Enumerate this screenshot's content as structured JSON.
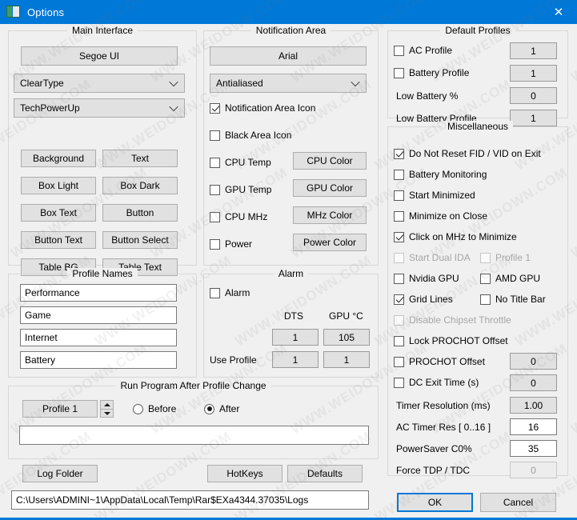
{
  "window": {
    "title": "Options",
    "icon": "app-icon",
    "close_label": "✕",
    "accent_color": "#0078d7"
  },
  "watermark": {
    "text": "WWW.WEIDOWN.COM"
  },
  "main_interface": {
    "legend": "Main Interface",
    "font_button": "Segoe UI",
    "rendering_combo": "ClearType",
    "theme_combo": "TechPowerUp",
    "color_buttons": [
      "Background",
      "Text",
      "Box Light",
      "Box Dark",
      "Box Text",
      "Button",
      "Button Text",
      "Button Select",
      "Table BG",
      "Table Text"
    ]
  },
  "notification_area": {
    "legend": "Notification Area",
    "font_button": "Arial",
    "rendering_combo": "Antialiased",
    "checks": [
      {
        "label": "Notification Area Icon",
        "checked": true
      },
      {
        "label": "Black Area Icon",
        "checked": false
      },
      {
        "label": "CPU Temp",
        "checked": false
      },
      {
        "label": "GPU Temp",
        "checked": false
      },
      {
        "label": "CPU MHz",
        "checked": false
      },
      {
        "label": "Power",
        "checked": false
      }
    ],
    "color_buttons": [
      "CPU Color",
      "GPU Color",
      "MHz Color",
      "Power Color"
    ]
  },
  "profile_names": {
    "legend": "Profile Names",
    "values": [
      "Performance",
      "Game",
      "Internet",
      "Battery"
    ]
  },
  "alarm": {
    "legend": "Alarm",
    "enable_label": "Alarm",
    "enable_checked": false,
    "col_dts": "DTS",
    "col_gpu": "GPU °C",
    "temp_dts": "1",
    "temp_gpu": "105",
    "use_profile_label": "Use Profile",
    "profile_dts": "1",
    "profile_gpu": "1"
  },
  "run_program": {
    "legend": "Run Program After Profile Change",
    "profile_button": "Profile 1",
    "radio_before": "Before",
    "radio_after": "After",
    "selected_radio": "After",
    "command_value": "",
    "command_placeholder": ""
  },
  "footer": {
    "log_folder_button": "Log Folder",
    "hotkeys_button": "HotKeys",
    "defaults_button": "Defaults",
    "log_path": "C:\\Users\\ADMINI~1\\AppData\\Local\\Temp\\Rar$EXa4344.37035\\Logs"
  },
  "default_profiles": {
    "legend": "Default Profiles",
    "rows": [
      {
        "label": "AC Profile",
        "type": "check",
        "checked": false,
        "value": "1",
        "field": "grey"
      },
      {
        "label": "Battery Profile",
        "type": "check",
        "checked": false,
        "value": "1",
        "field": "grey"
      },
      {
        "label": "Low Battery %",
        "type": "label",
        "checked": false,
        "value": "0",
        "field": "grey"
      },
      {
        "label": "Low Battery Profile",
        "type": "label",
        "checked": false,
        "value": "1",
        "field": "grey"
      }
    ]
  },
  "miscellaneous": {
    "legend": "Miscellaneous",
    "checks": [
      {
        "label": "Do Not Reset FID / VID on Exit",
        "checked": true,
        "disabled": false
      },
      {
        "label": "Battery Monitoring",
        "checked": false,
        "disabled": false
      },
      {
        "label": "Start Minimized",
        "checked": false,
        "disabled": false
      },
      {
        "label": "Minimize on Close",
        "checked": false,
        "disabled": false
      },
      {
        "label": "Click on MHz to Minimize",
        "checked": true,
        "disabled": false
      }
    ],
    "pairs": [
      {
        "left": {
          "label": "Start Dual IDA",
          "checked": false,
          "disabled": true
        },
        "right": {
          "label": "Profile 1",
          "checked": false,
          "disabled": true
        }
      },
      {
        "left": {
          "label": "Nvidia GPU",
          "checked": false,
          "disabled": false
        },
        "right": {
          "label": "AMD GPU",
          "checked": false,
          "disabled": false
        }
      },
      {
        "left": {
          "label": "Grid Lines",
          "checked": true,
          "disabled": false
        },
        "right": {
          "label": "No Title Bar",
          "checked": false,
          "disabled": false
        }
      }
    ],
    "chipset": {
      "label": "Disable Chipset Throttle",
      "checked": false,
      "disabled": true
    },
    "lock_prochot": {
      "label": "Lock PROCHOT Offset",
      "checked": false,
      "disabled": false
    },
    "value_rows": [
      {
        "label": "PROCHOT Offset",
        "type": "check",
        "checked": false,
        "value": "0",
        "field": "grey"
      },
      {
        "label": "DC Exit Time (s)",
        "type": "check",
        "checked": false,
        "value": "0",
        "field": "grey"
      },
      {
        "label": "Timer Resolution (ms)",
        "type": "label",
        "checked": false,
        "value": "1.00",
        "field": "grey"
      },
      {
        "label": "AC Timer Res [ 0..16 ]",
        "type": "label",
        "checked": false,
        "value": "16",
        "field": "white"
      },
      {
        "label": "PowerSaver C0%",
        "type": "label",
        "checked": false,
        "value": "35",
        "field": "white"
      },
      {
        "label": "Force TDP / TDC",
        "type": "label",
        "checked": false,
        "value": "0",
        "field": "disabled"
      }
    ]
  },
  "dialog_buttons": {
    "ok": "OK",
    "cancel": "Cancel"
  }
}
